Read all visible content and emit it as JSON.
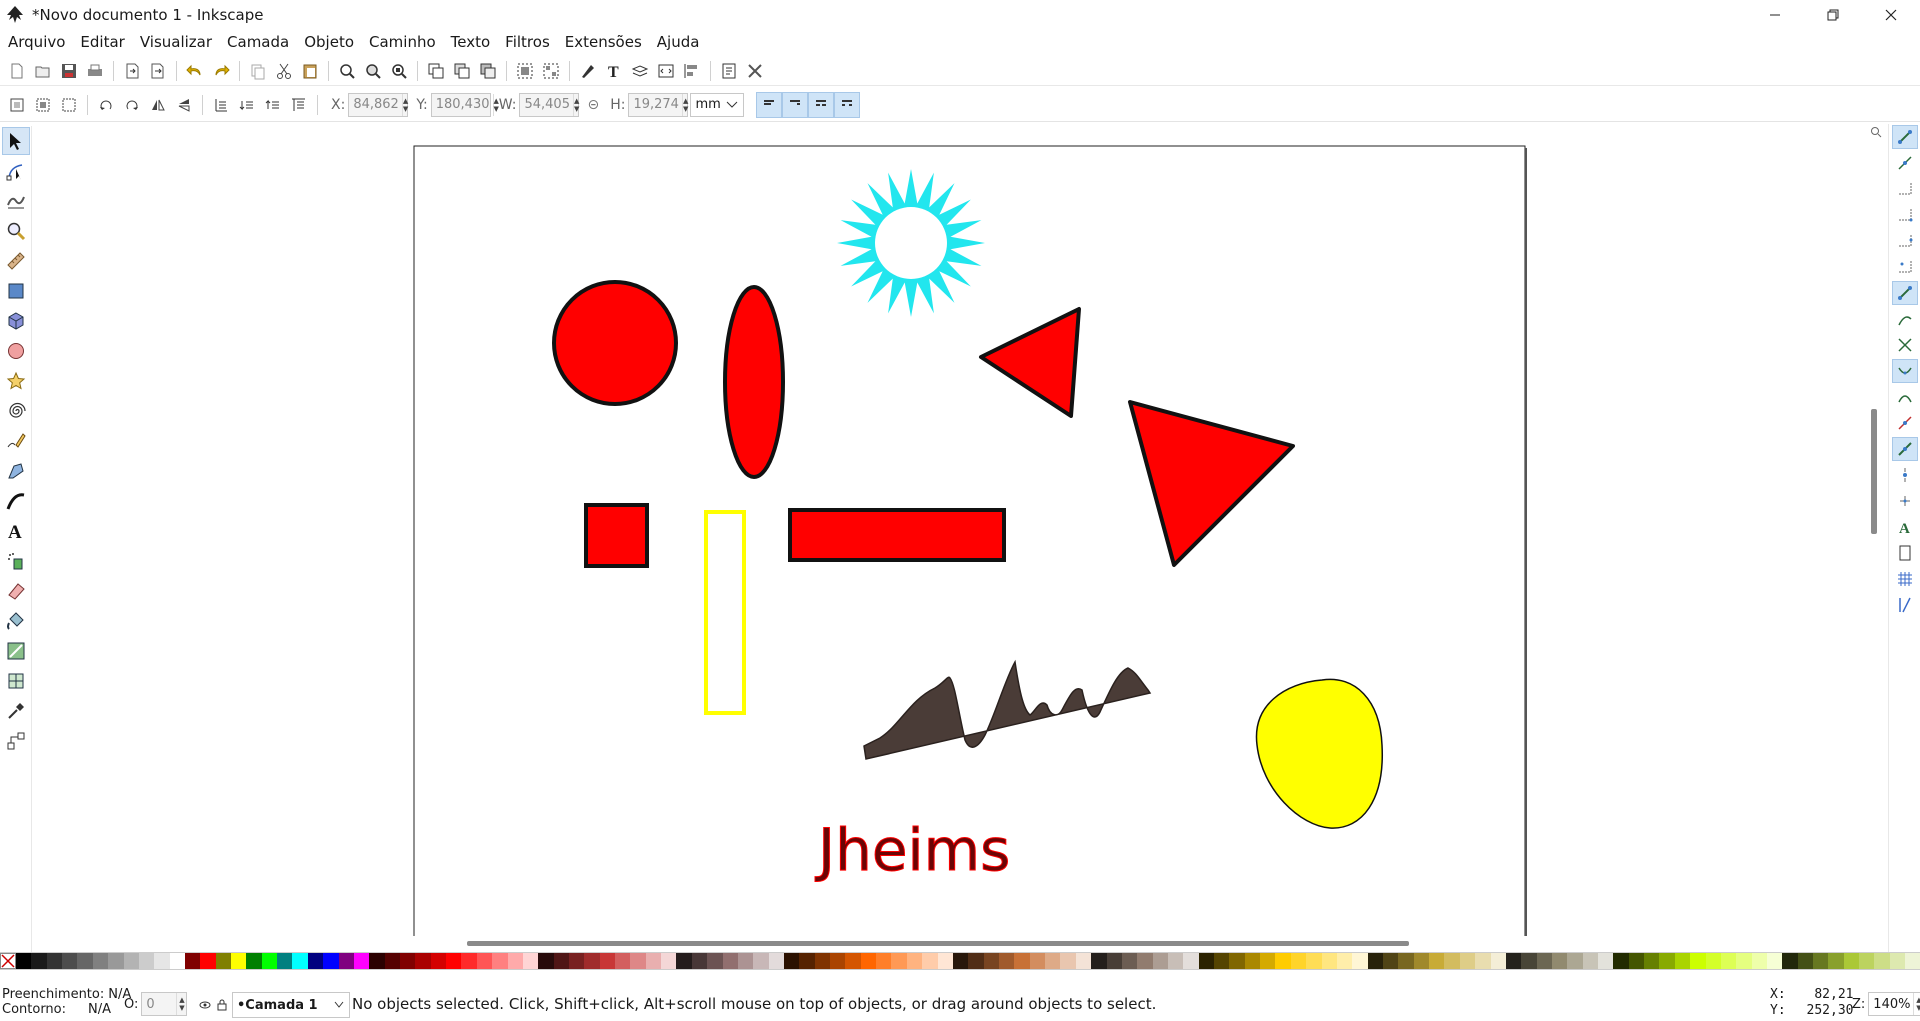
{
  "window": {
    "title": "*Novo documento 1 - Inkscape",
    "controls": [
      "minimize-icon",
      "restore-icon",
      "close-icon"
    ]
  },
  "menu": {
    "items": [
      "Arquivo",
      "Editar",
      "Visualizar",
      "Camada",
      "Objeto",
      "Caminho",
      "Texto",
      "Filtros",
      "Extensões",
      "Ajuda"
    ]
  },
  "command_bar": {
    "icons": [
      "new-document-icon",
      "open-icon",
      "save-icon",
      "print-icon",
      "import-icon",
      "export-icon",
      "undo-icon",
      "redo-icon",
      "copy-icon",
      "cut-icon",
      "paste-icon",
      "zoom-selection-icon",
      "zoom-drawing-icon",
      "zoom-page-icon",
      "duplicate-icon",
      "clone-icon",
      "unlink-clone-icon",
      "group-icon",
      "ungroup-icon",
      "fill-stroke-icon",
      "text-font-icon",
      "layers-icon",
      "xml-editor-icon",
      "align-distribute-icon",
      "document-properties-icon",
      "preferences-icon"
    ]
  },
  "tool_controls": {
    "x": {
      "label": "X:",
      "value": "84,862"
    },
    "y": {
      "label": "Y:",
      "value": "180,430"
    },
    "w": {
      "label": "W:",
      "value": "54,405"
    },
    "h": {
      "label": "H:",
      "value": "19,274"
    },
    "unit": "mm"
  },
  "toolbox": {
    "tools": [
      "selector-tool-icon",
      "node-tool-icon",
      "tweak-tool-icon",
      "zoom-tool-icon",
      "measure-tool-icon",
      "rectangle-tool-icon",
      "3d-box-tool-icon",
      "ellipse-tool-icon",
      "star-tool-icon",
      "spiral-tool-icon",
      "pencil-tool-icon",
      "pen-tool-icon",
      "calligraphy-tool-icon",
      "text-tool-icon",
      "spray-tool-icon",
      "eraser-tool-icon",
      "paint-bucket-tool-icon",
      "gradient-tool-icon",
      "mesh-tool-icon",
      "dropper-tool-icon",
      "connector-tool-icon"
    ],
    "active": "selector-tool-icon"
  },
  "canvas": {
    "text_object": "Jheims",
    "colors": {
      "red": "#ff0000",
      "cyan": "#22e6ee",
      "yellow": "#ffff00",
      "dark": "#4a3c37",
      "text_fill": "#6b0505"
    }
  },
  "snap_bar": {
    "icons": [
      "snap-toggle-icon",
      "snap-bbox-icon",
      "snap-bbox-edge-icon",
      "snap-bbox-corner-icon",
      "snap-bbox-midpoint-icon",
      "snap-bbox-center-icon",
      "snap-nodes-icon",
      "snap-path-icon",
      "snap-intersection-icon",
      "snap-cusp-icon",
      "snap-smooth-icon",
      "snap-midpoint-icon",
      "snap-others-icon",
      "snap-center-icon",
      "snap-rotation-center-icon",
      "snap-text-baseline-icon",
      "snap-page-border-icon",
      "snap-grid-icon",
      "snap-guide-icon"
    ]
  },
  "status": {
    "fill_label": "Preenchimento:",
    "fill_value": "N/A",
    "stroke_label": "Contorno:",
    "stroke_value": "N/A",
    "opacity_label": "O:",
    "opacity_value": "0",
    "layer": "•Camada 1",
    "message": "No objects selected. Click, Shift+click, Alt+scroll mouse on top of objects, or drag around objects to select.",
    "x_label": "X:",
    "x_value": "82,21",
    "y_label": "Y:",
    "y_value": "252,30",
    "zoom_label": "Z:",
    "zoom_value": "140%"
  }
}
